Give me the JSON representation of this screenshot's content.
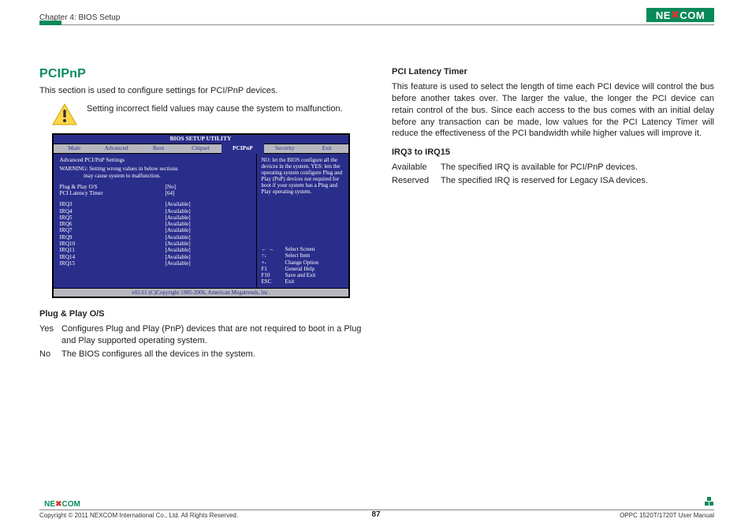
{
  "header": {
    "chapter": "Chapter 4: BIOS Setup",
    "brand": "NE COM",
    "brand_x": "X"
  },
  "left": {
    "title": "PCIPnP",
    "intro": "This section is used to configure settings for PCI/PnP devices.",
    "warning": "Setting incorrect field values may cause the system to malfunction.",
    "plugplay_head": "Plug & Play O/S",
    "pp_yes_term": "Yes",
    "pp_yes_desc": "Configures Plug and Play (PnP) devices that are not required to boot in a Plug and Play supported operating system.",
    "pp_no_term": "No",
    "pp_no_desc": "The BIOS configures all the devices in the system."
  },
  "bios": {
    "title": "BIOS SETUP UTILITY",
    "tabs": [
      "Main",
      "Advanced",
      "Boot",
      "Chipset",
      "PCIPnP",
      "Security",
      "Exit"
    ],
    "subtitle": "Advanced PCI/PnP Settings",
    "warn1": "WARNING: Setting wrong values in below sections",
    "warn2": "may cause system to malfunction.",
    "rows_top": [
      {
        "lbl": "Plug & Play O/S",
        "val": "[No]"
      },
      {
        "lbl": "PCI Latency Timer",
        "val": "[64]"
      }
    ],
    "rows_irq": [
      {
        "lbl": "IRQ3",
        "val": "[Available]"
      },
      {
        "lbl": "IRQ4",
        "val": "[Available]"
      },
      {
        "lbl": "IRQ5",
        "val": "[Available]"
      },
      {
        "lbl": "IRQ6",
        "val": "[Available]"
      },
      {
        "lbl": "IRQ7",
        "val": "[Available]"
      },
      {
        "lbl": "IRQ9",
        "val": "[Available]"
      },
      {
        "lbl": "IRQ10",
        "val": "[Available]"
      },
      {
        "lbl": "IRQ11",
        "val": "[Available]"
      },
      {
        "lbl": "IRQ14",
        "val": "[Available]"
      },
      {
        "lbl": "IRQ15",
        "val": "[Available]"
      }
    ],
    "help": "NO: let the BIOS configure all the devices in the system. YES: lets the operating system configure Plug and Play (PnP) devices not required for boot if your system has a Plug and Play operating system.",
    "keys": [
      {
        "k": "← →",
        "d": "Select Screen"
      },
      {
        "k": "↑↓",
        "d": "Select Item"
      },
      {
        "k": "+-",
        "d": "Change Option"
      },
      {
        "k": "F1",
        "d": "General Help"
      },
      {
        "k": "F10",
        "d": "Save and Exit"
      },
      {
        "k": "ESC",
        "d": "Exit"
      }
    ],
    "footer": "v02.61 (C)Copyright 1985-2006, American Megatrends, Inc."
  },
  "right": {
    "head1": "PCI Latency Timer",
    "body1": "This feature is used to select the length of time each PCI device will control the bus before another takes over. The larger the value, the longer the PCI device can retain control of the bus. Since each access to the bus comes with an initial delay before any transaction can be made, low values for the PCI Latency Timer will reduce the effectiveness of the PCI bandwidth while higher values will improve it.",
    "head2": "IRQ3 to IRQ15",
    "avail_term": "Available",
    "avail_desc": "The specified IRQ is available for PCI/PnP devices.",
    "res_term": "Reserved",
    "res_desc": "The specified IRQ is reserved for Legacy ISA devices."
  },
  "footer": {
    "brand": "NE COM",
    "brand_x": "X",
    "copyright": "Copyright © 2011 NEXCOM International Co., Ltd. All Rights Reserved.",
    "page": "87",
    "model": "OPPC 1520T/1720T User Manual"
  }
}
